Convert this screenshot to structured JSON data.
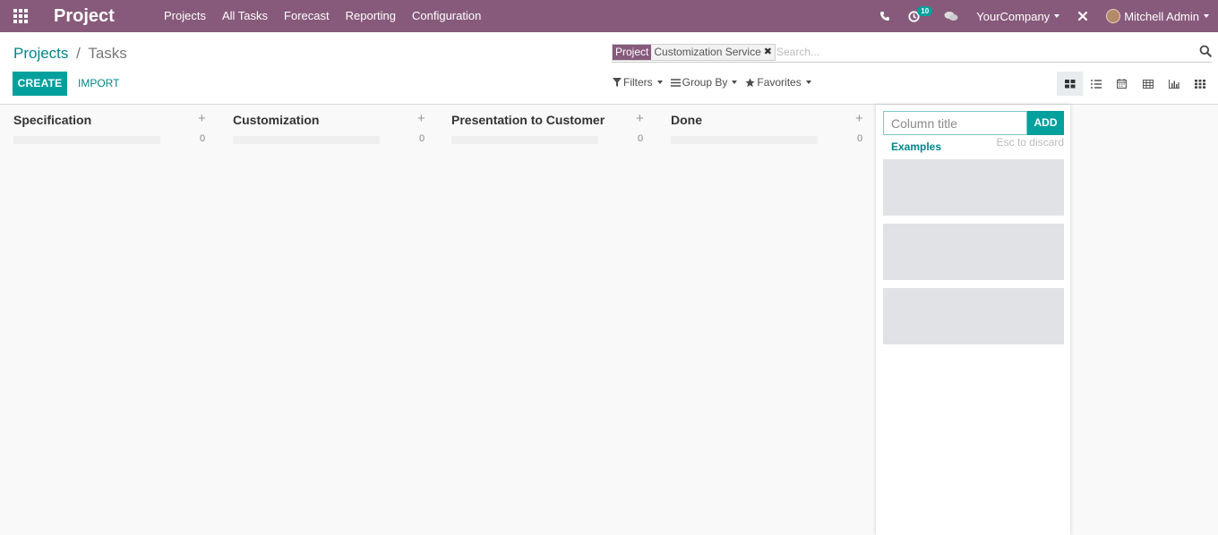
{
  "navbar": {
    "app_title": "Project",
    "menu": [
      "Projects",
      "All Tasks",
      "Forecast",
      "Reporting",
      "Configuration"
    ],
    "activity_badge": "10",
    "company": "YourCompany",
    "user": "Mitchell Admin",
    "icons": [
      "apps-icon",
      "phone-icon",
      "clock-icon",
      "chat-icon",
      "tools-icon",
      "avatar"
    ]
  },
  "breadcrumb": {
    "parent": "Projects",
    "separator": "/",
    "current": "Tasks"
  },
  "buttons": {
    "create": "CREATE",
    "import": "IMPORT"
  },
  "search": {
    "facet_label": "Project",
    "facet_value": "Customization Service",
    "placeholder": "Search..."
  },
  "filters": {
    "filters": "Filters",
    "group_by": "Group By",
    "favorites": "Favorites"
  },
  "views": [
    "kanban",
    "list",
    "calendar",
    "pivot",
    "graph",
    "activity"
  ],
  "active_view": "kanban",
  "kanban": {
    "columns": [
      {
        "title": "Specification",
        "count": "0"
      },
      {
        "title": "Customization",
        "count": "0"
      },
      {
        "title": "Presentation to Customer",
        "count": "0"
      },
      {
        "title": "Done",
        "count": "0"
      }
    ],
    "quick_create": {
      "placeholder": "Column title",
      "add_label": "ADD",
      "examples_label": "Examples",
      "esc_hint": "Esc to discard"
    }
  },
  "colors": {
    "navbar": "#875a7b",
    "primary": "#00a09d",
    "link": "#00868b"
  }
}
